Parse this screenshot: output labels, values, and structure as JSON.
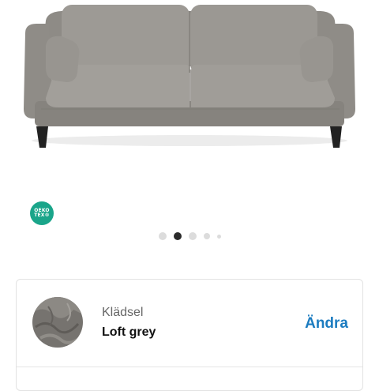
{
  "product": {
    "gallery": {
      "image_icon": "grey-sofa",
      "total_slides": 5,
      "active_slide": 2
    },
    "certification": {
      "icon": "oeko-tex-badge",
      "line1": "OEKO",
      "line2": "TEX®",
      "color": "#1aa58a"
    },
    "upholstery": {
      "label": "Klädsel",
      "value": "Loft grey",
      "action": "Ändra",
      "swatch_icon": "fabric-swatch",
      "action_color": "#1c7cc0"
    }
  }
}
